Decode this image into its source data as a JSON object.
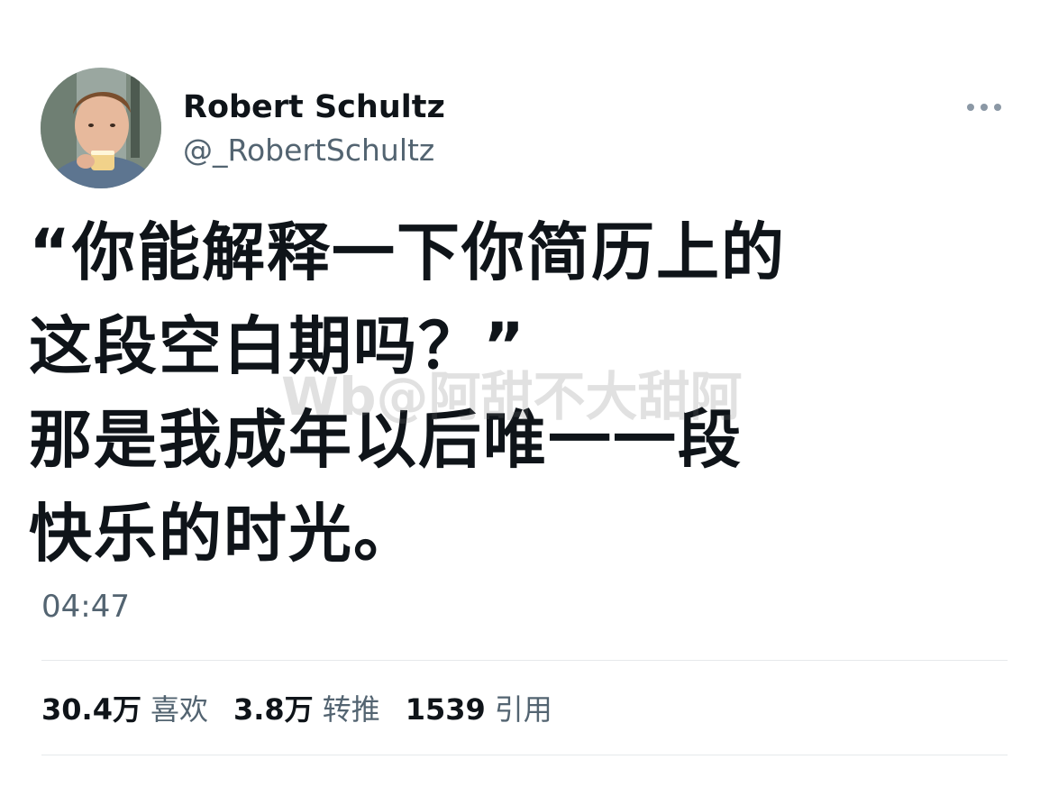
{
  "author": {
    "name": "Robert Schultz",
    "handle": "@_RobertSchultz",
    "avatar_icon": "profile-photo-icon"
  },
  "menu": {
    "more_icon": "more-options-icon"
  },
  "tweet": {
    "lines": [
      "“你能解释一下你简历上的",
      "这段空白期吗？”",
      "那是我成年以后唯一一段",
      "快乐的时光。"
    ],
    "time": "04:47"
  },
  "watermark": "Wb@阿甜不大甜阿",
  "stats": {
    "likes_value": "30.4万",
    "likes_label": "喜欢",
    "retweets_value": "3.8万",
    "retweets_label": "转推",
    "quotes_value": "1539",
    "quotes_label": "引用"
  },
  "colors": {
    "text_primary": "#0f1419",
    "text_secondary": "#536471",
    "divider": "#e6e9eb"
  }
}
